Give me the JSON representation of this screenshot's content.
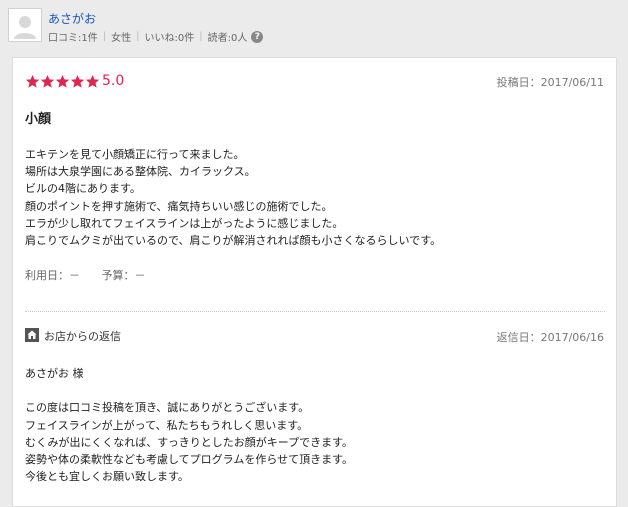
{
  "user": {
    "name": "あさがお",
    "reviews": "口コミ:1件",
    "gender": "女性",
    "likes": "いいね:0件",
    "readers": "読者:0人",
    "help_icon": "question-circle-icon"
  },
  "review": {
    "rating": 5,
    "score_label": "5.0",
    "star_color": "#e0254f",
    "posted_date": "投稿日：2017/06/11",
    "title": "小顔",
    "body": [
      "エキテンを見て小顔矯正に行って来ました。",
      "場所は大泉学園にある整体院、カイラックス。",
      "ビルの4階にあります。",
      "顔のポイントを押す施術で、痛気持ちいい感じの施術でした。",
      "エラが少し取れてフェイスラインは上がったように感じました。",
      "肩こりでムクミが出ているので、肩こりが解消されれば顔も小さくなるらしいです。"
    ],
    "usage_date": "利用日：－",
    "budget": "予算：－"
  },
  "shop_reply": {
    "icon": "home-icon",
    "label": "お店からの返信",
    "reply_date": "返信日：2017/06/16",
    "body": [
      "あさがお 様",
      "",
      "この度は口コミ投稿を頂き、誠にありがとうございます。",
      "フェイスラインが上がって、私たちもうれしく思います。",
      "むくみが出にくくなれば、すっきりとしたお顔がキープできます。",
      "姿勢や体の柔軟性なども考慮してプログラムを作らせて頂きます。",
      "今後とも宜しくお願い致します。"
    ]
  }
}
